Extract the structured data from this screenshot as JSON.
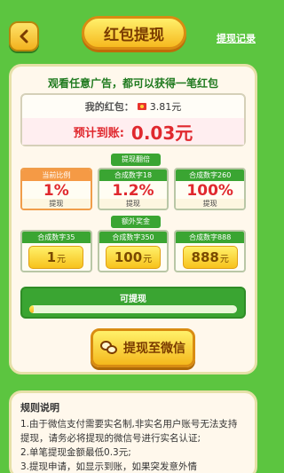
{
  "header": {
    "title": "红包提现",
    "record_link": "提现记录"
  },
  "main": {
    "headline": "观看任意广告，都可以获得一笔红包",
    "balance_label": "我的红包：",
    "balance_value": "3.81元",
    "expect_label": "预计到账:",
    "expect_value": "0.03元"
  },
  "withdraw_multiplier": {
    "section_label": "提现翻倍",
    "tiers": [
      {
        "header": "当前比例",
        "value": "1%",
        "footer": "提现",
        "active": true
      },
      {
        "header": "合成数字18",
        "value": "1.2%",
        "footer": "提现",
        "active": false
      },
      {
        "header": "合成数字260",
        "value": "100%",
        "footer": "提现",
        "active": false
      }
    ]
  },
  "extra_bonus": {
    "section_label": "额外奖金",
    "items": [
      {
        "header": "合成数字35",
        "amount": "1",
        "unit": "元"
      },
      {
        "header": "合成数字350",
        "amount": "100",
        "unit": "元"
      },
      {
        "header": "合成数字888",
        "amount": "888",
        "unit": "元"
      }
    ]
  },
  "withdrawable": {
    "label": "可提现",
    "progress": 0.02
  },
  "actions": {
    "wechat_button": "提现至微信"
  },
  "rules": {
    "title": "规则说明",
    "line1": "1.由于微信支付需要实名制,非实名用户账号无法支持提现，请务必将提现的微信号进行实名认证;",
    "line2": "2.单笔提现金额最低0.3元;",
    "line3": "3.提现申请，如显示到账，如果突发意外情"
  },
  "colors": {
    "background": "#5cc540",
    "accent_red": "#e0282e",
    "accent_gold": "#f5b81c"
  }
}
